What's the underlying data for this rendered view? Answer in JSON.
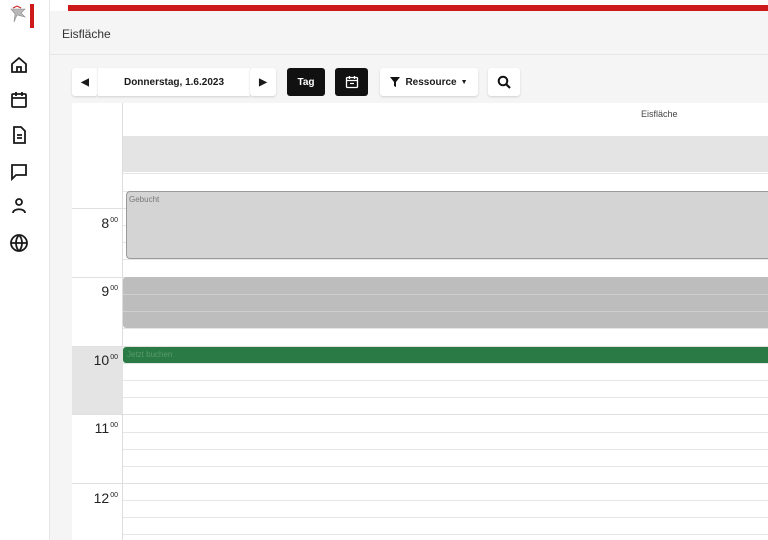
{
  "header": {
    "title": "Eisfläche"
  },
  "toolbar": {
    "prev_icon": "caret-left-icon",
    "date_label": "Donnerstag, 1.6.2023",
    "next_icon": "caret-right-icon",
    "view_label": "Tag",
    "calendar_icon": "calendar-icon",
    "filter_label": "Ressource",
    "search_icon": "search-icon"
  },
  "sidebar": {
    "items": [
      {
        "icon": "home-icon"
      },
      {
        "icon": "calendar-icon"
      },
      {
        "icon": "document-icon"
      },
      {
        "icon": "chat-icon"
      },
      {
        "icon": "user-icon"
      },
      {
        "icon": "globe-icon"
      }
    ]
  },
  "calendar": {
    "resource": "Eisfläche",
    "hours": [
      {
        "h": "8",
        "m": "00"
      },
      {
        "h": "9",
        "m": "00"
      },
      {
        "h": "10",
        "m": "00"
      },
      {
        "h": "11",
        "m": "00"
      },
      {
        "h": "12",
        "m": "00"
      }
    ],
    "events": {
      "gebucht": "Gebucht",
      "book_now": "Jetzt buchen"
    }
  },
  "colors": {
    "brand_red": "#cc1a1a",
    "book_green": "#2a7a45",
    "dark_button": "#111111"
  }
}
